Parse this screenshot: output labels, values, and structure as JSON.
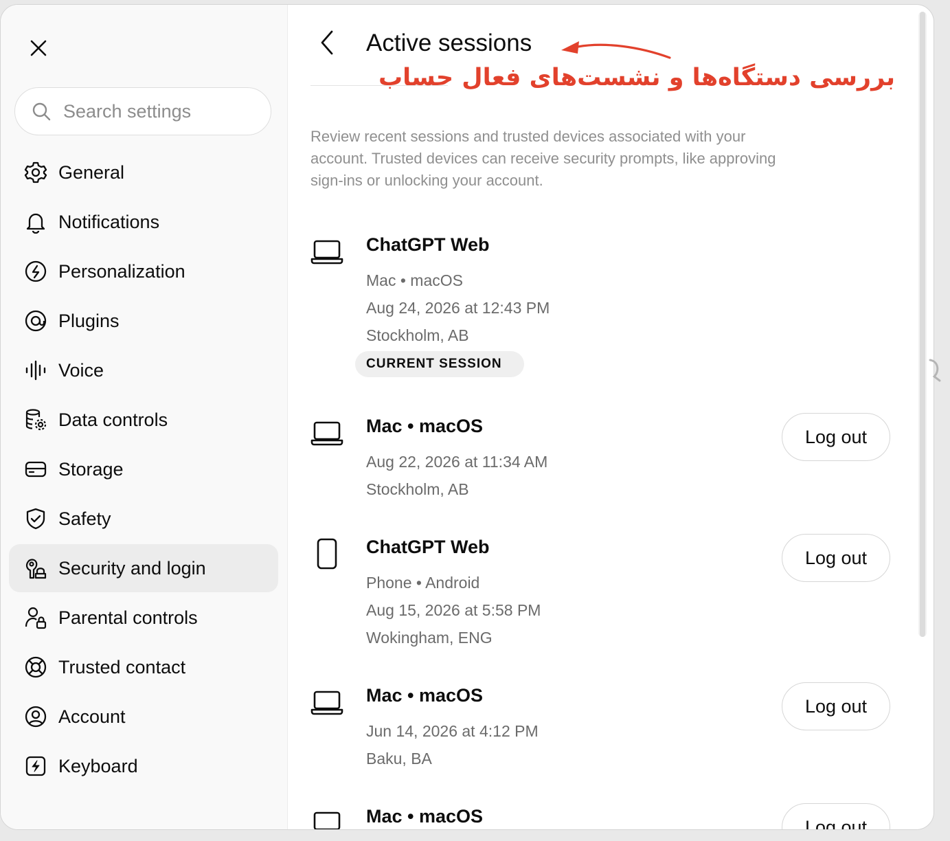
{
  "sidebar": {
    "search_placeholder": "Search settings",
    "items": [
      {
        "label": "General",
        "icon": "gear-icon"
      },
      {
        "label": "Notifications",
        "icon": "bell-icon"
      },
      {
        "label": "Personalization",
        "icon": "personalization-icon"
      },
      {
        "label": "Plugins",
        "icon": "plugins-icon"
      },
      {
        "label": "Voice",
        "icon": "voice-wave-icon"
      },
      {
        "label": "Data controls",
        "icon": "database-gear-icon"
      },
      {
        "label": "Storage",
        "icon": "storage-drive-icon"
      },
      {
        "label": "Safety",
        "icon": "shield-check-icon"
      },
      {
        "label": "Security and login",
        "icon": "key-lock-icon",
        "active": true
      },
      {
        "label": "Parental controls",
        "icon": "person-lock-icon"
      },
      {
        "label": "Trusted contact",
        "icon": "lifebuoy-icon"
      },
      {
        "label": "Account",
        "icon": "user-circle-icon"
      },
      {
        "label": "Keyboard",
        "icon": "keyboard-bolt-icon"
      }
    ]
  },
  "main": {
    "title": "Active sessions",
    "annotation": "بررسی دستگاه‌ها و نشست‌های فعال حساب",
    "description": "Review recent sessions and trusted devices associated with your account. Trusted devices can receive security prompts, like approving sign-ins or unlocking your account.",
    "logout_label": "Log out",
    "current_badge": "CURRENT SESSION",
    "sessions": [
      {
        "title": "ChatGPT Web",
        "device": "Mac • macOS",
        "time": "Aug 24, 2026 at 12:43 PM",
        "location": "Stockholm, AB",
        "icon": "laptop-icon",
        "current": true
      },
      {
        "title": "Mac • macOS",
        "time": "Aug 22, 2026 at 11:34 AM",
        "location": "Stockholm, AB",
        "icon": "laptop-icon"
      },
      {
        "title": "ChatGPT Web",
        "device": "Phone • Android",
        "time": "Aug 15, 2026 at 5:58 PM",
        "location": "Wokingham, ENG",
        "icon": "phone-icon"
      },
      {
        "title": "Mac • macOS",
        "time": "Jun 14, 2026 at 4:12 PM",
        "location": "Baku, BA",
        "icon": "laptop-icon"
      },
      {
        "title": "Mac • macOS",
        "icon": "laptop-icon"
      }
    ]
  },
  "colors": {
    "accent_annotation": "#e2412c",
    "active_item_bg": "#ececec"
  }
}
